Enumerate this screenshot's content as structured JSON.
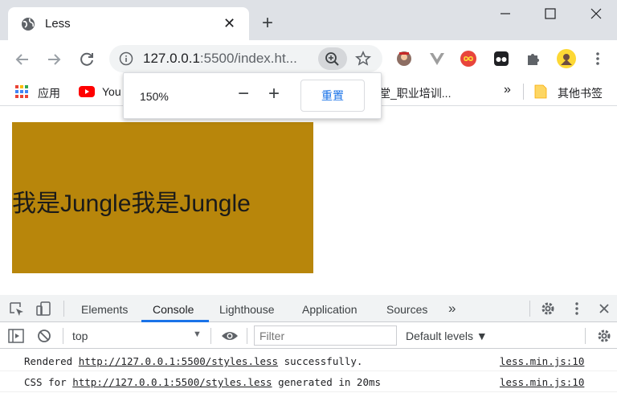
{
  "browser": {
    "tab": {
      "title": "Less",
      "close": "✕"
    },
    "new_tab": "+",
    "omnibox": {
      "host": "127.0.0.1",
      "rest": ":5500/index.ht..."
    },
    "bookmarks": [
      {
        "label": "应用",
        "icon": "apps-grid-icon"
      },
      {
        "label": "You",
        "icon": "youtube-icon"
      },
      {
        "label": "课堂_职业培训...",
        "icon": "none"
      },
      {
        "label": "»",
        "icon": "none"
      },
      {
        "label": "其他书签",
        "icon": "folder-icon"
      }
    ],
    "colors": {
      "tabstrip": "#dee1e6",
      "accent": "#1a73e8"
    }
  },
  "zoom_popup": {
    "level": "150%",
    "minus": "−",
    "plus": "+",
    "reset_label": "重置"
  },
  "page": {
    "box_text": "我是Jungle我是Jungle",
    "box_color": "#b8860b"
  },
  "devtools": {
    "tabs": [
      "Elements",
      "Console",
      "Lighthouse",
      "Application",
      "Sources"
    ],
    "active_tab": "Console",
    "more_tabs": "»",
    "context": "top",
    "filter_placeholder": "Filter",
    "levels_label": "Default levels ▼",
    "logs": [
      {
        "pre": "Rendered ",
        "link": "http://127.0.0.1:5500/styles.less",
        "post": " successfully.",
        "source": "less.min.js:10"
      },
      {
        "pre": "CSS for ",
        "link": "http://127.0.0.1:5500/styles.less",
        "post": " generated in 20ms",
        "source": "less.min.js:10"
      }
    ]
  }
}
